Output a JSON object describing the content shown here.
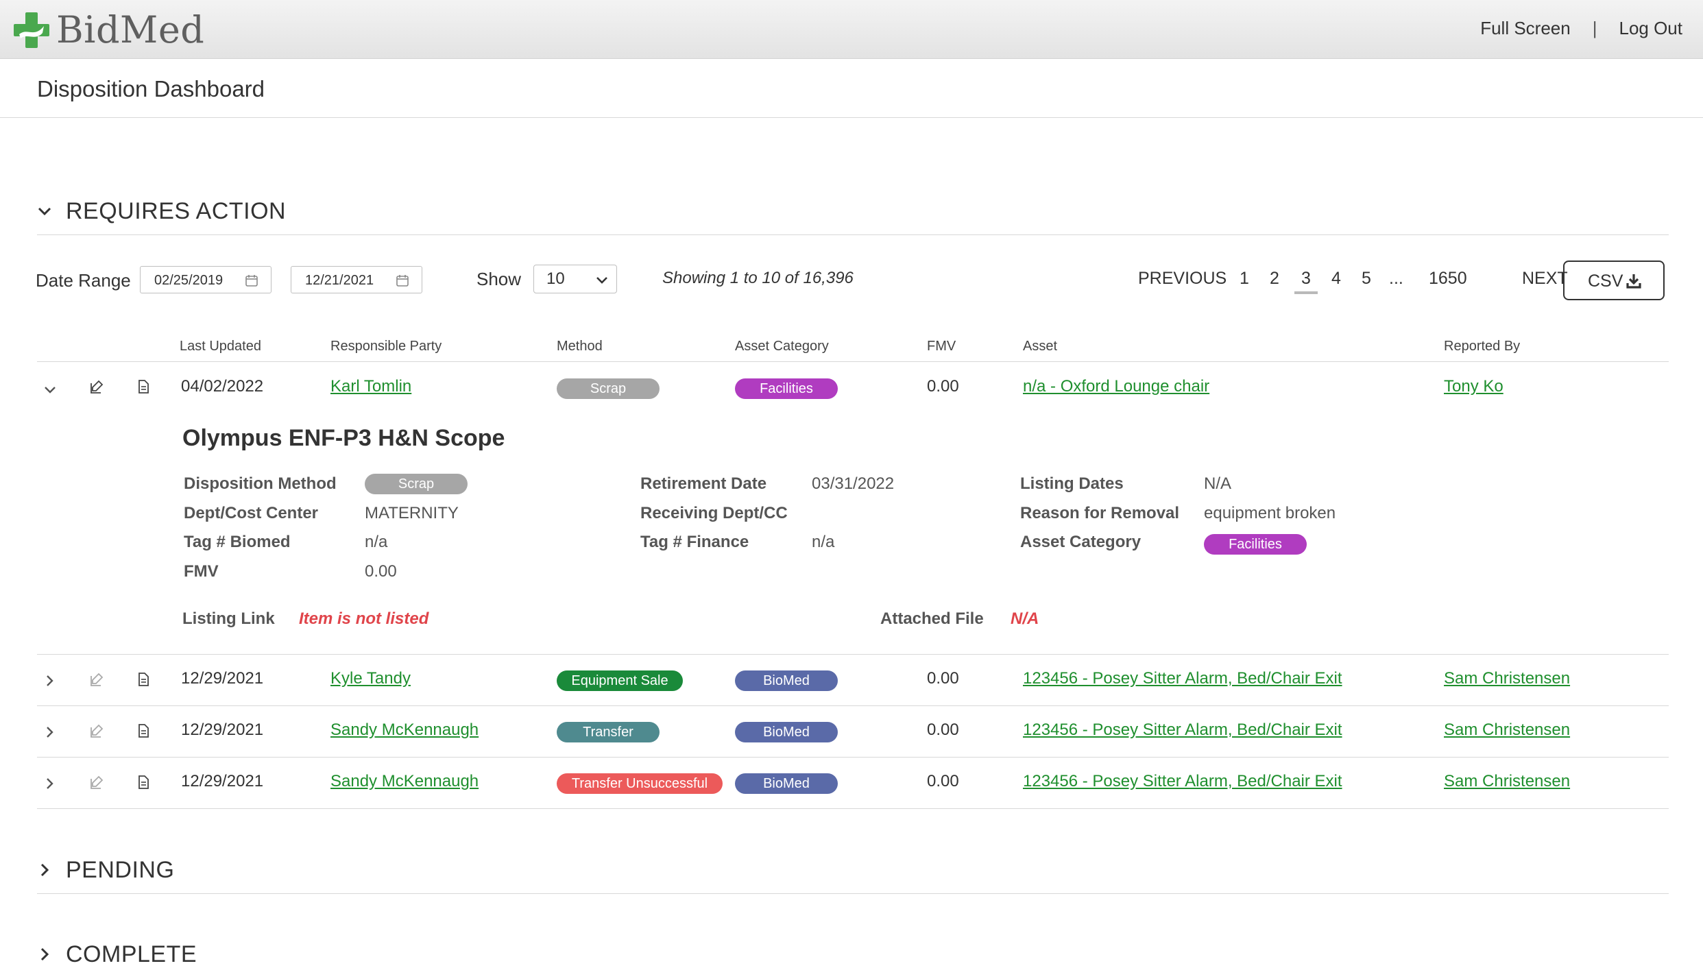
{
  "app": {
    "logo_text": "BidMed",
    "full_screen": "Full Screen",
    "separator": "|",
    "log_out": "Log Out"
  },
  "page": {
    "title": "Disposition Dashboard"
  },
  "sections": {
    "requires_action": "REQUIRES ACTION",
    "pending": "PENDING",
    "complete": "COMPLETE"
  },
  "toolbar": {
    "date_range_label": "Date Range",
    "date_from": "02/25/2019",
    "date_to": "12/21/2021",
    "show_label": "Show",
    "show_value": "10",
    "showing_text": "Showing 1 to 10 of 16,396",
    "pagination": {
      "previous": "PREVIOUS",
      "pages": [
        "1",
        "2",
        "3",
        "4",
        "5",
        "...",
        "1650"
      ],
      "current": "3",
      "next": "NEXT"
    },
    "csv_label": "CSV"
  },
  "table": {
    "headers": {
      "last_updated": "Last Updated",
      "responsible_party": "Responsible Party",
      "method": "Method",
      "asset_category": "Asset Category",
      "fmv": "FMV",
      "asset": "Asset",
      "reported_by": "Reported By"
    },
    "rows": [
      {
        "date": "04/02/2022",
        "party": "Karl Tomlin",
        "method": "Scrap",
        "category": "Facilities",
        "fmv": "0.00",
        "asset": "n/a - Oxford Lounge chair",
        "reporter": "Tony Ko"
      },
      {
        "date": "12/29/2021",
        "party": "Kyle Tandy",
        "method": "Equipment Sale",
        "category": "BioMed",
        "fmv": "0.00",
        "asset": "123456 - Posey Sitter Alarm, Bed/Chair Exit",
        "reporter": "Sam Christensen"
      },
      {
        "date": "12/29/2021",
        "party": "Sandy McKennaugh",
        "method": "Transfer",
        "category": "BioMed",
        "fmv": "0.00",
        "asset": "123456 - Posey Sitter Alarm, Bed/Chair Exit",
        "reporter": "Sam Christensen"
      },
      {
        "date": "12/29/2021",
        "party": "Sandy McKennaugh",
        "method": "Transfer Unsuccessful",
        "category": "BioMed",
        "fmv": "0.00",
        "asset": "123456 - Posey Sitter Alarm, Bed/Chair Exit",
        "reporter": "Sam Christensen"
      }
    ]
  },
  "detail": {
    "title": "Olympus ENF-P3 H&N Scope",
    "labels": {
      "disposition_method": "Disposition Method",
      "dept_cost_center": "Dept/Cost Center",
      "tag_biomed": "Tag # Biomed",
      "fmv": "FMV",
      "retirement_date": "Retirement Date",
      "receiving_dept": "Receiving Dept/CC",
      "tag_finance": "Tag # Finance",
      "listing_dates": "Listing Dates",
      "reason_for_removal": "Reason for Removal",
      "asset_category": "Asset Category",
      "listing_link": "Listing Link",
      "attached_file": "Attached File"
    },
    "values": {
      "disposition_method": "Scrap",
      "dept_cost_center": "MATERNITY",
      "tag_biomed": "n/a",
      "fmv": "0.00",
      "retirement_date": "03/31/2022",
      "receiving_dept": "",
      "tag_finance": "n/a",
      "listing_dates": "N/A",
      "reason_for_removal": "equipment broken",
      "asset_category": "Facilities",
      "listing_link": "Item is not listed",
      "attached_file": "N/A"
    }
  },
  "colors": {
    "link_green": "#1f8f2e",
    "scrap": "#a6a6a6",
    "facilities": "#b03cc0",
    "biomed": "#5a6aa8",
    "equipment_sale": "#1a8a3a",
    "transfer": "#4f8a8f",
    "transfer_unsuccessful": "#ec5a5a",
    "logo_green": "#4aa84e",
    "alert_red": "#e0444a"
  },
  "icons": [
    "plus-cross-logo-icon",
    "calendar-icon",
    "chevron-down-icon",
    "chevron-right-icon",
    "edit-icon",
    "document-icon",
    "download-icon"
  ]
}
